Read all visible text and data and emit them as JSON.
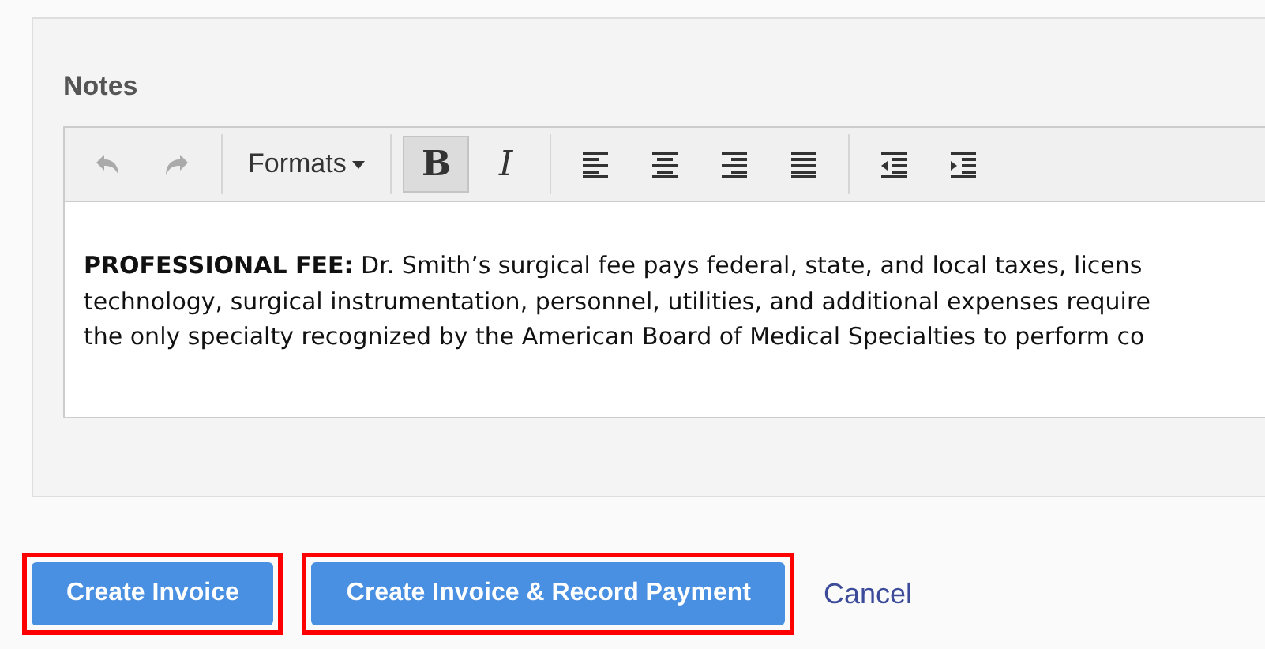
{
  "notes": {
    "label": "Notes",
    "toolbar": [
      {
        "kind": "undo",
        "disabled": true,
        "pressed": false
      },
      {
        "kind": "redo",
        "disabled": true,
        "pressed": false
      },
      {
        "kind": "separator"
      },
      {
        "kind": "dropdown",
        "label": "Formats"
      },
      {
        "kind": "separator"
      },
      {
        "kind": "bold",
        "label": "B",
        "disabled": false,
        "pressed": true
      },
      {
        "kind": "italic",
        "label": "I",
        "disabled": false,
        "pressed": false
      },
      {
        "kind": "separator"
      },
      {
        "kind": "align-left",
        "disabled": false,
        "pressed": false
      },
      {
        "kind": "align-center",
        "disabled": false,
        "pressed": false
      },
      {
        "kind": "align-right",
        "disabled": false,
        "pressed": false
      },
      {
        "kind": "justify",
        "disabled": false,
        "pressed": false
      },
      {
        "kind": "separator"
      },
      {
        "kind": "outdent",
        "disabled": false,
        "pressed": false
      },
      {
        "kind": "indent",
        "disabled": false,
        "pressed": false
      }
    ],
    "lines": [
      "**PROFESSIONAL FEE:** Dr. Smith’s surgical fee pays federal, state, and local taxes, licens",
      "technology, surgical instrumentation, personnel, utilities, and additional expenses require",
      "the only specialty recognized by the American Board of Medical Specialties to perform co"
    ]
  },
  "actions": [
    {
      "kind": "button",
      "label": "Create Invoice",
      "highlighted": true
    },
    {
      "kind": "button",
      "label": "Create Invoice & Record Payment",
      "highlighted": true
    },
    {
      "kind": "link",
      "label": "Cancel",
      "highlighted": false
    }
  ]
}
